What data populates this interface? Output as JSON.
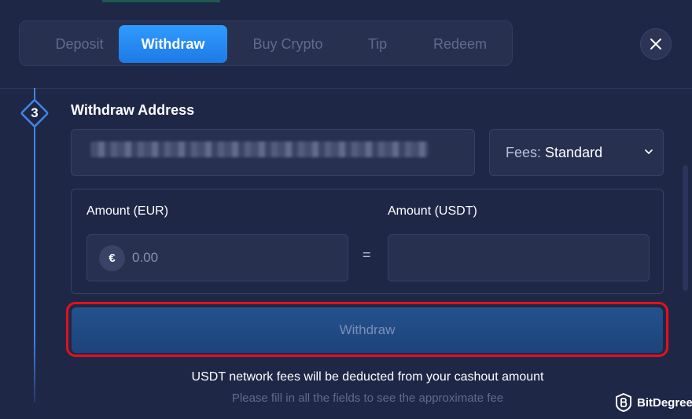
{
  "tabs": [
    {
      "label": "Deposit",
      "active": false
    },
    {
      "label": "Withdraw",
      "active": true
    },
    {
      "label": "Buy Crypto",
      "active": false
    },
    {
      "label": "Tip",
      "active": false
    },
    {
      "label": "Redeem",
      "active": false
    }
  ],
  "close_icon": "close-icon",
  "step": {
    "number": "3",
    "title": "Withdraw Address"
  },
  "address": {
    "value": "",
    "obscured": true
  },
  "fees": {
    "label": "Fees:",
    "value": "Standard",
    "icon": "chevron-down-icon"
  },
  "amount": {
    "eur_label": "Amount (EUR)",
    "usdt_label": "Amount (USDT)",
    "currency_symbol": "€",
    "eur_placeholder": "0.00",
    "equals": "=",
    "usdt_value": ""
  },
  "withdraw_button": {
    "label": "Withdraw",
    "enabled": false
  },
  "notes": {
    "fee_note": "USDT network fees will be deducted from your cashout amount",
    "fee_hint": "Please fill in all the fields to see the approximate fee"
  },
  "watermark": {
    "text": "BitDegree"
  },
  "colors": {
    "background": "#1f2747",
    "accent": "#2f9bff",
    "highlight": "#e5101d",
    "button": "#24528d"
  }
}
